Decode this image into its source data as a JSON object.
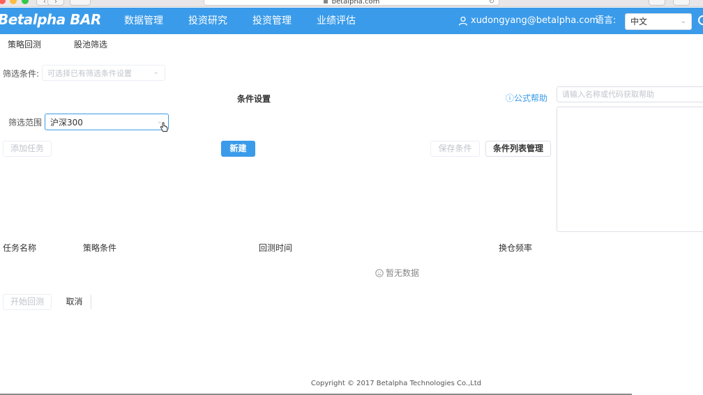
{
  "browser": {
    "url": "betalpha.com"
  },
  "header": {
    "logo": "Betalpha BAR",
    "nav": [
      "数据管理",
      "投资研究",
      "投资管理",
      "业绩评估"
    ],
    "user_email": "xudongyang@betalpha.com",
    "language_label": "语言:",
    "language_value": "中文",
    "accent_color": "#3a9bea"
  },
  "subtabs": [
    "策略回测",
    "股池筛选"
  ],
  "filter": {
    "condition_label": "筛选条件:",
    "condition_placeholder": "可选择已有筛选条件设置",
    "section_title": "条件设置",
    "help_link": "公式帮助",
    "range_label": "筛选范围",
    "range_value": "沪深300"
  },
  "help_panel": {
    "search_placeholder": "请输入名称或代码获取帮助"
  },
  "buttons": {
    "add_task": "添加任务",
    "new": "新建",
    "save_condition": "保存条件",
    "condition_list": "条件列表管理",
    "start_backtest": "开始回测",
    "cancel": "取消"
  },
  "table": {
    "columns": [
      "任务名称",
      "策略条件",
      "回测时间",
      "换仓频率"
    ],
    "empty_text": "暂无数据"
  },
  "footer": "Copyright © 2017 Betalpha Technologies Co.,Ltd"
}
